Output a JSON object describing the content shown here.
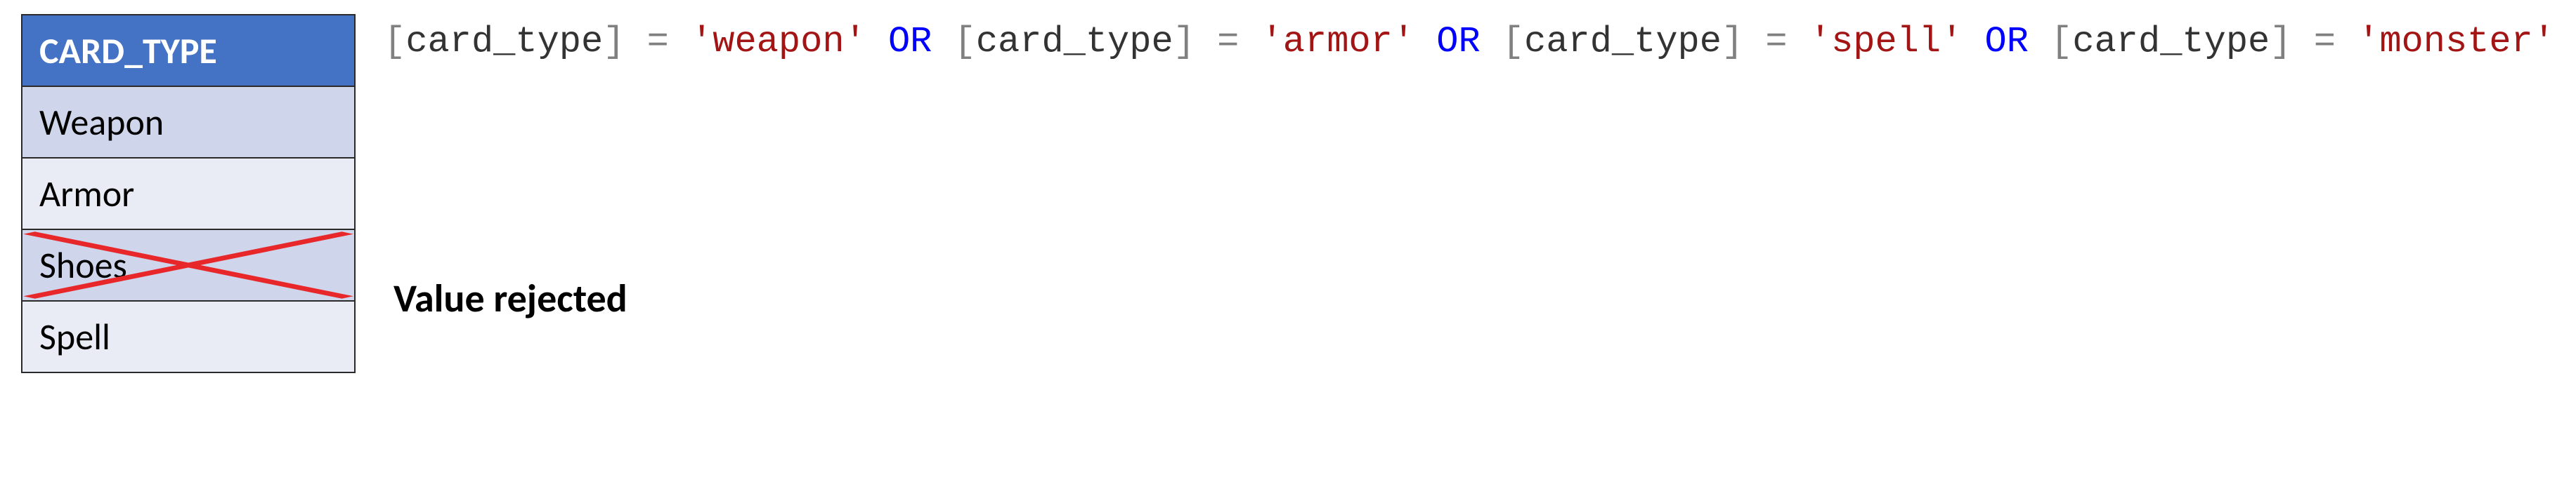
{
  "table": {
    "header": "CARD_TYPE",
    "rows": [
      {
        "value": "Weapon",
        "rejected": false
      },
      {
        "value": "Armor",
        "rejected": false
      },
      {
        "value": "Shoes",
        "rejected": true
      },
      {
        "value": "Spell",
        "rejected": false
      }
    ]
  },
  "rejected_label": "Value rejected",
  "expression": {
    "field": "card_type",
    "operator": "OR",
    "comparator": "=",
    "allowed_values": [
      "weapon",
      "armor",
      "spell",
      "monster"
    ]
  }
}
